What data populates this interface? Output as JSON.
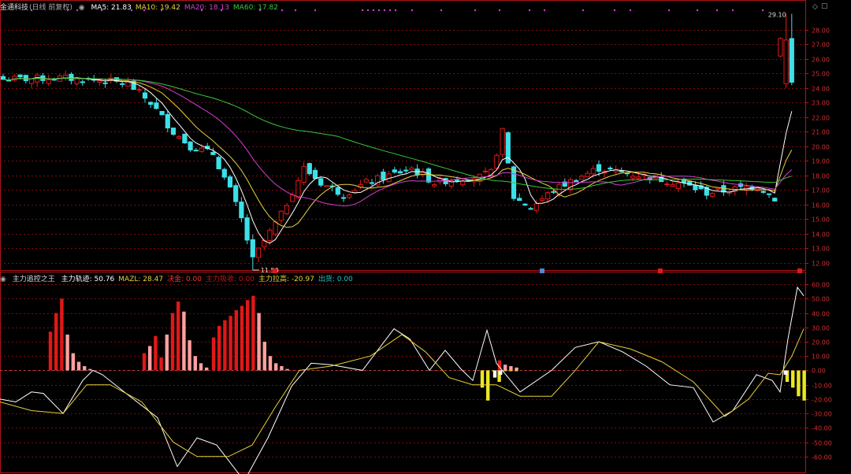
{
  "price_panel": {
    "stock_name": "金通科技",
    "period": "(日线 前复权)",
    "indicators": [
      {
        "label": "MA5:",
        "value": "21.83",
        "color": "#ffffff"
      },
      {
        "label": "MA10:",
        "value": "19.42",
        "color": "#e8d23a"
      },
      {
        "label": "MA20:",
        "value": "18.13",
        "color": "#d040d0"
      },
      {
        "label": "MA60:",
        "value": "17.82",
        "color": "#38c838"
      }
    ],
    "y_ticks": [
      "28.00",
      "27.00",
      "26.00",
      "25.00",
      "24.00",
      "23.00",
      "22.00",
      "21.00",
      "20.00",
      "19.00",
      "18.00",
      "17.00",
      "16.00",
      "15.00",
      "14.00",
      "13.00",
      "12.00"
    ],
    "y_range": [
      11.5,
      29.4
    ],
    "high_label": "29.10",
    "low_label": "11.50",
    "markers": [
      "融",
      "通",
      "融"
    ]
  },
  "indicator_panel": {
    "name": "主力追控之王",
    "items": [
      {
        "label": "主力轨迹:",
        "value": "50.76",
        "color": "#ffffff"
      },
      {
        "label": "MAZL:",
        "value": "28.47",
        "color": "#e8d23a"
      },
      {
        "label": "决金:",
        "value": "0.00",
        "color": "#ff3030"
      },
      {
        "label": "主力吸收:",
        "value": "0.00",
        "color": "#c01818"
      },
      {
        "label": "主力拉高:",
        "value": "-20.97",
        "color": "#e8d23a"
      },
      {
        "label": "出货:",
        "value": "0.00",
        "color": "#20c0c0"
      }
    ],
    "y_ticks": [
      "60.00",
      "50.00",
      "40.00",
      "30.00",
      "20.00",
      "10.00",
      "0.00",
      "-10.00",
      "-20.00",
      "-30.00",
      "-40.00",
      "-50.00",
      "-60.00"
    ],
    "y_range": [
      -70,
      65
    ]
  },
  "colors": {
    "up": "#e01818",
    "down": "#3ce0e8",
    "grid": "#7a0e0e",
    "axis": "#b01414"
  }
}
